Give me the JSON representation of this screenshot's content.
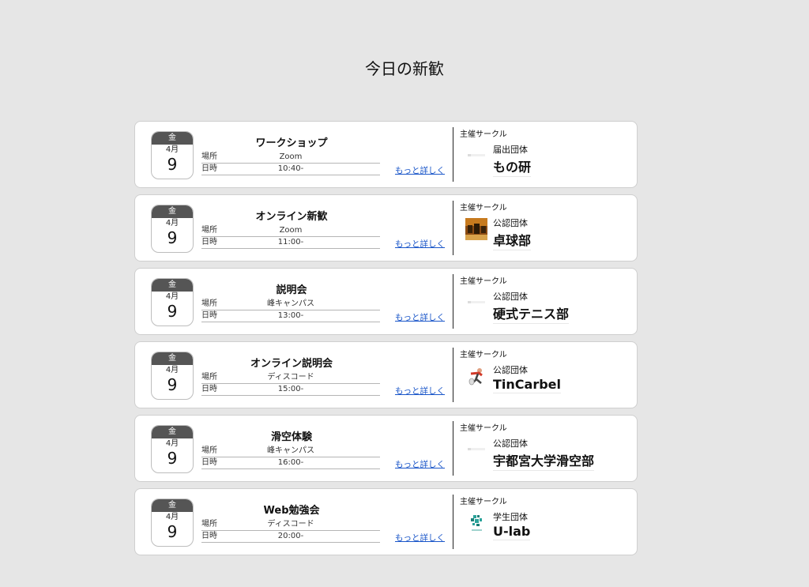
{
  "page": {
    "title": "今日の新歓"
  },
  "labels": {
    "place": "場所",
    "time": "日時",
    "more": "もっと詳しく",
    "host": "主催サークル"
  },
  "events": [
    {
      "dow": "金",
      "month": "4月",
      "day": "9",
      "title": "ワークショップ",
      "place": "Zoom",
      "time": "10:40-",
      "host_type": "届出団体",
      "host_name": "もの研",
      "host_logo": "placeholder-logo"
    },
    {
      "dow": "金",
      "month": "4月",
      "day": "9",
      "title": "オンライン新歓",
      "place": "Zoom",
      "time": "11:00-",
      "host_type": "公認団体",
      "host_name": "卓球部",
      "host_logo": "photo-logo"
    },
    {
      "dow": "金",
      "month": "4月",
      "day": "9",
      "title": "説明会",
      "place": "峰キャンパス",
      "time": "13:00-",
      "host_type": "公認団体",
      "host_name": "硬式テニス部",
      "host_logo": "placeholder-logo"
    },
    {
      "dow": "金",
      "month": "4月",
      "day": "9",
      "title": "オンライン説明会",
      "place": "ディスコード",
      "time": "15:00-",
      "host_type": "公認団体",
      "host_name": "TinCarbel",
      "host_logo": "figure-logo"
    },
    {
      "dow": "金",
      "month": "4月",
      "day": "9",
      "title": "滑空体験",
      "place": "峰キャンパス",
      "time": "16:00-",
      "host_type": "公認団体",
      "host_name": "宇都宮大学滑空部",
      "host_logo": "placeholder-logo"
    },
    {
      "dow": "金",
      "month": "4月",
      "day": "9",
      "title": "Web勉強会",
      "place": "ディスコード",
      "time": "20:00-",
      "host_type": "学生団体",
      "host_name": "U-lab",
      "host_logo": "ulab-logo"
    }
  ],
  "colors": {
    "background": "#e6e6e6",
    "card": "#ffffff",
    "calendar_header": "#555555",
    "link": "#1a56c9"
  }
}
